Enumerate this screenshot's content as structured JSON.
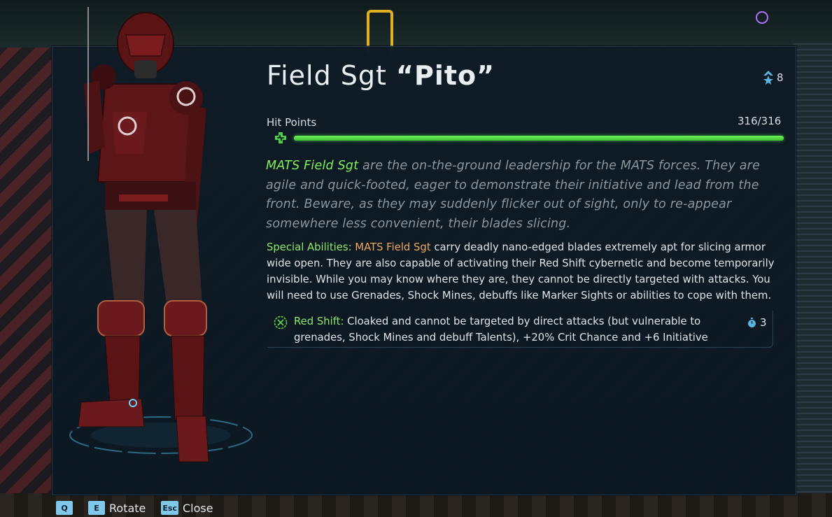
{
  "unit": {
    "rank_title": "Field Sgt",
    "nickname": "Pito",
    "rank_level": "8"
  },
  "hit_points": {
    "label": "Hit Points",
    "value": "316/316",
    "fraction": 1.0
  },
  "lore": {
    "highlight": "MATS Field Sgt",
    "text": " are the on-the-ground leadership for the MATS forces. They are agile and quick-footed, eager to demonstrate their initiative and lead from the front. Beware, as they may suddenly flicker out of sight, only to re-appear somewhere less convenient, their blades slicing."
  },
  "special_abilities": {
    "label": "Special Abilities:",
    "unit_name": "MATS Field Sgt",
    "text": " carry deadly nano-edged blades extremely apt for slicing armor wide open. They are also capable of activating their Red Shift cybernetic and become temporarily invisible. While you may know where they are, they cannot be directly targeted with attacks. You will need to use Grenades, Shock Mines, debuffs like Marker Sights or abilities to cope with them."
  },
  "talent": {
    "name": "Red Shift:",
    "text": " Cloaked and cannot be targeted by direct attacks (but vulnerable to grenades, Shock Mines and debuff Talents), +20% Crit Chance and +6 Initiative",
    "cooldown": "3",
    "icon": "crossed-circle-icon"
  },
  "hints": {
    "key_q": "Q",
    "key_e": "E",
    "rotate": "Rotate",
    "key_esc": "Esc",
    "close": "Close"
  },
  "colors": {
    "accent_green": "#8fe86a",
    "unit_orange": "#f0a85a",
    "hp_bar": "#5ee84a",
    "panel_bg": "#0e1b26",
    "key_bg": "#7fc8ea"
  }
}
